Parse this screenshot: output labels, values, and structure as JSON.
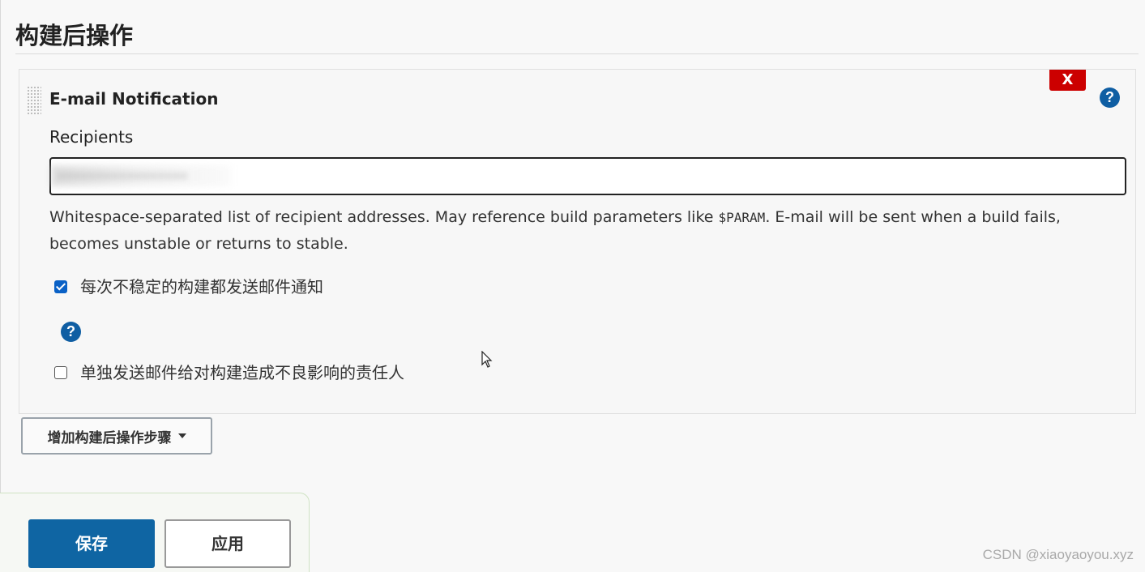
{
  "section": {
    "title": "构建后操作"
  },
  "email_notification": {
    "title": "E-mail Notification",
    "delete_label": "X",
    "help_icon": "question-icon",
    "recipients_label": "Recipients",
    "recipients_value": "•••••••••••••••••",
    "help_text_before": "Whitespace-separated list of recipient addresses. May reference build parameters like ",
    "help_text_code": "$PARAM",
    "help_text_after": ". E-mail will be sent when a build fails, becomes unstable or returns to stable.",
    "options": [
      {
        "label": "每次不稳定的构建都发送邮件通知",
        "checked": true
      },
      {
        "label": "单独发送邮件给对构建造成不良影响的责任人",
        "checked": false
      }
    ]
  },
  "add_step_button": {
    "label": "增加构建后操作步骤"
  },
  "footer": {
    "save_label": "保存",
    "apply_label": "应用"
  },
  "watermark": "CSDN @xiaoyaoyou.xyz",
  "colors": {
    "accent": "#0f65a3",
    "danger": "#cc0000",
    "checkbox": "#0a61c6"
  }
}
